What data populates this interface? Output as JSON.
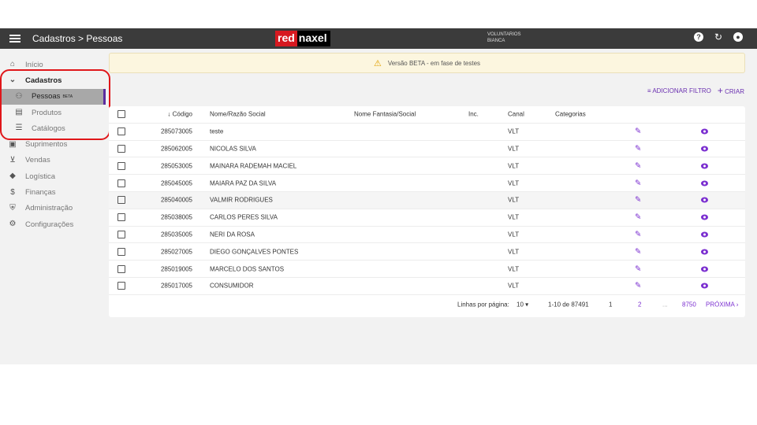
{
  "header": {
    "breadcrumb": "Cadastros > Pessoas",
    "logo_red": "red",
    "logo_black": "naxel",
    "org_line1": "VOLUNTARIOS",
    "org_line2": "BIANCA"
  },
  "sidebar": {
    "items": [
      {
        "label": "Início",
        "icon": "home-icon",
        "glyph": "⌂"
      },
      {
        "label": "Cadastros",
        "icon": "chevron-down-icon",
        "glyph": "⌄"
      },
      {
        "label": "Pessoas",
        "icon": "people-icon",
        "glyph": "👥",
        "badge": "BETA"
      },
      {
        "label": "Produtos",
        "icon": "box-icon",
        "glyph": "▤"
      },
      {
        "label": "Catálogos",
        "icon": "list-icon",
        "glyph": "☰"
      },
      {
        "label": "Suprimentos",
        "icon": "supplies-icon",
        "glyph": "▣"
      },
      {
        "label": "Vendas",
        "icon": "cart-icon",
        "glyph": "🛒"
      },
      {
        "label": "Logística",
        "icon": "logistics-icon",
        "glyph": "◆"
      },
      {
        "label": "Finanças",
        "icon": "finance-icon",
        "glyph": "$"
      },
      {
        "label": "Administração",
        "icon": "shield-icon",
        "glyph": "⛨"
      },
      {
        "label": "Configurações",
        "icon": "gear-icon",
        "glyph": "⚙"
      }
    ]
  },
  "banner": {
    "text": "Versão BETA - em fase de testes"
  },
  "toolbar": {
    "filter_label": "ADICIONAR FILTRO",
    "create_label": "CRIAR"
  },
  "table": {
    "headers": {
      "codigo": "Código",
      "nome": "Nome/Razão Social",
      "fantasia": "Nome Fantasia/Social",
      "inc": "Inc.",
      "canal": "Canal",
      "categorias": "Categorias"
    },
    "rows": [
      {
        "codigo": "285073005",
        "nome": "teste",
        "canal": "VLT"
      },
      {
        "codigo": "285062005",
        "nome": "NICOLAS SILVA",
        "canal": "VLT"
      },
      {
        "codigo": "285053005",
        "nome": "MAINARA RADEMAH MACIEL",
        "canal": "VLT"
      },
      {
        "codigo": "285045005",
        "nome": "MAIARA PAZ DA SILVA",
        "canal": "VLT"
      },
      {
        "codigo": "285040005",
        "nome": "VALMIR RODRIGUES",
        "canal": "VLT"
      },
      {
        "codigo": "285038005",
        "nome": "CARLOS PERES SILVA",
        "canal": "VLT"
      },
      {
        "codigo": "285035005",
        "nome": "NERI DA ROSA",
        "canal": "VLT"
      },
      {
        "codigo": "285027005",
        "nome": "DIEGO GONÇALVES PONTES",
        "canal": "VLT"
      },
      {
        "codigo": "285019005",
        "nome": "MARCELO DOS SANTOS",
        "canal": "VLT"
      },
      {
        "codigo": "285017005",
        "nome": "CONSUMIDOR",
        "canal": "VLT"
      }
    ]
  },
  "pagination": {
    "rows_label": "Linhas por página:",
    "rows_value": "10",
    "range": "1-10 de 87491",
    "page1": "1",
    "page2": "2",
    "dots": "...",
    "last": "8750",
    "next": "PRÓXIMA"
  }
}
